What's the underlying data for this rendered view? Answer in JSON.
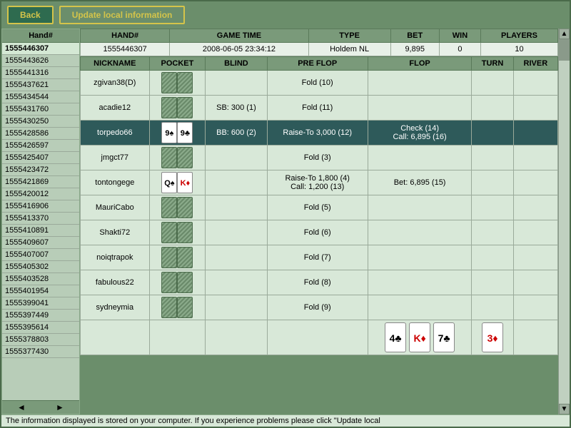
{
  "toolbar": {
    "back_label": "Back",
    "update_label": "Update local information"
  },
  "hand_list": {
    "header": "Hand#",
    "hands": [
      {
        "id": "1555446307",
        "selected": true
      },
      {
        "id": "1555443626"
      },
      {
        "id": "1555441316"
      },
      {
        "id": "1555437621"
      },
      {
        "id": "1555434544"
      },
      {
        "id": "1555431760"
      },
      {
        "id": "1555430250"
      },
      {
        "id": "1555428586"
      },
      {
        "id": "1555426597"
      },
      {
        "id": "1555425407"
      },
      {
        "id": "1555423472"
      },
      {
        "id": "1555421869"
      },
      {
        "id": "1555420012"
      },
      {
        "id": "1555416906"
      },
      {
        "id": "1555413370"
      },
      {
        "id": "1555410891"
      },
      {
        "id": "1555409607"
      },
      {
        "id": "1555407007"
      },
      {
        "id": "1555405302"
      },
      {
        "id": "1555403528"
      },
      {
        "id": "1555401954"
      },
      {
        "id": "1555399041"
      },
      {
        "id": "1555397449"
      },
      {
        "id": "1555395614"
      },
      {
        "id": "1555378803"
      },
      {
        "id": "1555377430"
      }
    ]
  },
  "summary": {
    "cols": [
      "HAND#",
      "GAME TIME",
      "TYPE",
      "BET",
      "WIN",
      "PLAYERS"
    ],
    "row": {
      "hand_num": "1555446307",
      "game_time": "2008-06-05 23:34:12",
      "type": "Holdem NL",
      "bet": "9,895",
      "win": "0",
      "players": "10"
    }
  },
  "detail": {
    "cols": [
      "NICKNAME",
      "POCKET",
      "BLIND",
      "PRE FLOP",
      "FLOP",
      "TURN",
      "RIVER"
    ],
    "rows": [
      {
        "nickname": "zgivan38(D)",
        "pocket": "back",
        "blind": "",
        "preflop": "Fold (10)",
        "flop": "",
        "turn": "",
        "river": "",
        "highlight": false
      },
      {
        "nickname": "acadie12",
        "pocket": "back",
        "blind": "SB: 300 (1)",
        "preflop": "Fold (11)",
        "flop": "",
        "turn": "",
        "river": "",
        "highlight": false
      },
      {
        "nickname": "torpedo66",
        "pocket": "9s9c",
        "blind": "BB: 600 (2)",
        "preflop": "Raise-To 3,000 (12)",
        "flop": "Check (14)\nCall: 6,895 (16)",
        "turn": "",
        "river": "",
        "highlight": true
      },
      {
        "nickname": "jmgct77",
        "pocket": "back",
        "blind": "",
        "preflop": "Fold (3)",
        "flop": "",
        "turn": "",
        "river": "",
        "highlight": false
      },
      {
        "nickname": "tontongege",
        "pocket": "QsKd",
        "blind": "",
        "preflop": "Raise-To 1,800 (4)\nCall: 1,200 (13)",
        "flop": "Bet: 6,895 (15)",
        "turn": "",
        "river": "",
        "highlight": false
      },
      {
        "nickname": "MauriCabo",
        "pocket": "back",
        "blind": "",
        "preflop": "Fold (5)",
        "flop": "",
        "turn": "",
        "river": "",
        "highlight": false
      },
      {
        "nickname": "Shakti72",
        "pocket": "back",
        "blind": "",
        "preflop": "Fold (6)",
        "flop": "",
        "turn": "",
        "river": "",
        "highlight": false
      },
      {
        "nickname": "noiqtrapok",
        "pocket": "back",
        "blind": "",
        "preflop": "Fold (7)",
        "flop": "",
        "turn": "",
        "river": "",
        "highlight": false
      },
      {
        "nickname": "fabulous22",
        "pocket": "back",
        "blind": "",
        "preflop": "Fold (8)",
        "flop": "",
        "turn": "",
        "river": "",
        "highlight": false
      },
      {
        "nickname": "sydneymia",
        "pocket": "back",
        "blind": "",
        "preflop": "Fold (9)",
        "flop": "",
        "turn": "",
        "river": "",
        "highlight": false
      },
      {
        "nickname": "",
        "pocket": "",
        "blind": "",
        "preflop": "",
        "flop": "community",
        "turn": "community_turn",
        "river": "community_river",
        "highlight": false,
        "is_community": true
      }
    ]
  },
  "community_cards": {
    "flop": [
      {
        "rank": "4",
        "suit": "♣",
        "color": "black"
      },
      {
        "rank": "K",
        "suit": "♦",
        "color": "red"
      },
      {
        "rank": "7",
        "suit": "♣",
        "color": "black"
      }
    ],
    "turn": [
      {
        "rank": "3",
        "suit": "♦",
        "color": "red"
      }
    ],
    "river": []
  },
  "status_bar": {
    "text": "The information displayed is stored on your computer. If you experience problems please click \"Update local"
  }
}
